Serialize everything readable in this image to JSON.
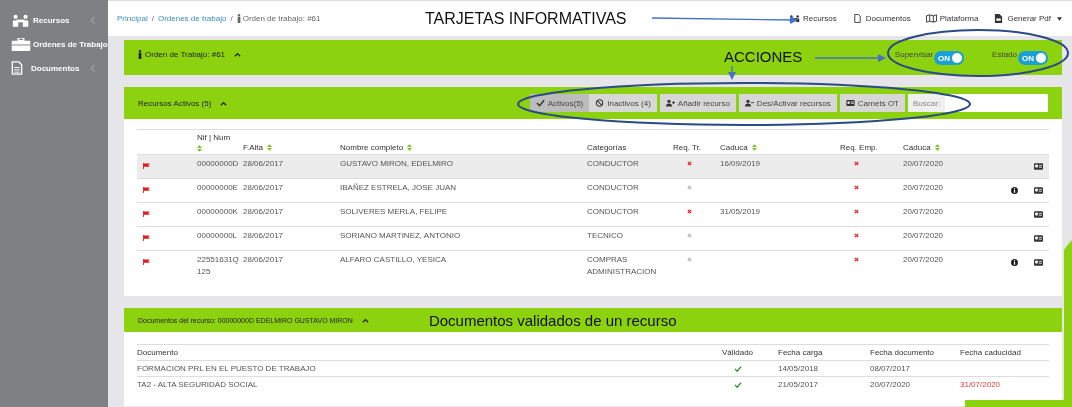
{
  "sidebar": {
    "items": [
      {
        "label": "Recursos",
        "expandable": true
      },
      {
        "label": "Ordenes de Trabajo",
        "expandable": false
      },
      {
        "label": "Documentos",
        "expandable": true
      }
    ]
  },
  "top_bar": {
    "breadcrumb": [
      {
        "label": "Principal",
        "link": true
      },
      {
        "separator": "/"
      },
      {
        "label": "Ordenes de trabajo",
        "link": true
      },
      {
        "separator": "/"
      },
      {
        "label": "Orden de trabajo: #61",
        "link": false
      }
    ],
    "annotation": "TARJETAS INFORMATIVAS",
    "nav": [
      {
        "label": "Recursos",
        "dropdown": false
      },
      {
        "label": "Documentos",
        "dropdown": false
      },
      {
        "label": "Plataforma",
        "dropdown": false
      },
      {
        "label": "Generar Pdf",
        "dropdown": true
      }
    ]
  },
  "order_panel": {
    "title": "Orden de Trabajo: #61",
    "annotation": "ACCIONES",
    "toggles": [
      {
        "label": "Supervisar",
        "state_text": "ON",
        "on": true
      },
      {
        "label": "Estado",
        "state_text": "ON",
        "on": true
      }
    ]
  },
  "resources": {
    "title": "Recursos Activos (5)",
    "filters": [
      {
        "label": "Activos(5)",
        "selected": true
      },
      {
        "label": "Inactivos (4)",
        "selected": false
      }
    ],
    "actions": [
      {
        "label": "Añadir recurso"
      },
      {
        "label": "Des/Activar recursos"
      },
      {
        "label": "Carnets OT"
      }
    ],
    "search_label": "Buscar:",
    "columns": [
      {
        "label": "Nif | Num",
        "sortable": true
      },
      {
        "label": "F.Alta",
        "sortable": true
      },
      {
        "label": "Nombre completo",
        "sortable": true
      },
      {
        "label": "Categorías",
        "sortable": false
      },
      {
        "label": "Req. Tr.",
        "sortable": false
      },
      {
        "label": "Caduca",
        "sortable": true
      },
      {
        "label": "Req. Emp.",
        "sortable": false
      },
      {
        "label": "Caduca",
        "sortable": true
      }
    ],
    "rows": [
      {
        "nif": "00000000D",
        "falta": "28/06/2017",
        "name": "GUSTAVO MIRON, EDELMIRO",
        "category": "CONDUCTOR",
        "req_tr_missing": true,
        "caduca_tr": "16/09/2019",
        "req_emp_missing": true,
        "caduca_emp": "20/07/2020",
        "info": false,
        "selected": true
      },
      {
        "nif": "00000000E",
        "falta": "28/06/2017",
        "name": "IBAÑEZ ESTRELA, JOSE JUAN",
        "category": "CONDUCTOR",
        "req_tr_missing": false,
        "req_emp_missing": true,
        "caduca_emp": "20/07/2020",
        "info": true,
        "selected": false
      },
      {
        "nif": "00000000K",
        "falta": "28/06/2017",
        "name": "SOLIVERES MERLA, FELIPE",
        "category": "CONDUCTOR",
        "req_tr_missing": true,
        "caduca_tr": "31/05/2019",
        "req_emp_missing": true,
        "caduca_emp": "20/07/2020",
        "info": false,
        "selected": false
      },
      {
        "nif": "00000000L",
        "falta": "28/06/2017",
        "name": "SORIANO MARTINEZ, ANTONIO",
        "category": "TECNICO",
        "req_tr_missing": false,
        "req_emp_missing": true,
        "caduca_emp": "20/07/2020",
        "info": false,
        "selected": false
      },
      {
        "nif": "22551631Q",
        "num": "125",
        "falta": "28/06/2017",
        "name": "ALFARO CASTILLO, YESICA",
        "category": "COMPRAS",
        "category_2": "ADMINISTRACION",
        "req_tr_missing": false,
        "req_emp_missing": true,
        "caduca_emp": "20/07/2020",
        "info": true,
        "selected": false
      }
    ]
  },
  "documents": {
    "title": "Documentos del recurso: 00000000D EDELMIRO GUSTAVO MIRON",
    "annotation": "Documentos validados de un recurso",
    "columns": [
      "Documento",
      "Válidado",
      "Fecha carga",
      "Fecha documento",
      "Fecha caducidad"
    ],
    "rows": [
      {
        "name": "FORMACION PRL EN EL PUESTO DE TRABAJO",
        "validated": true,
        "uploaded": "14/05/2018",
        "doc_date": "08/07/2017"
      },
      {
        "name": "TA2 - ALTA SEGURIDAD SOCIAL",
        "validated": true,
        "uploaded": "21/05/2017",
        "doc_date": "20/07/2020",
        "expiry": "31/07/2020",
        "expired": true
      }
    ]
  }
}
